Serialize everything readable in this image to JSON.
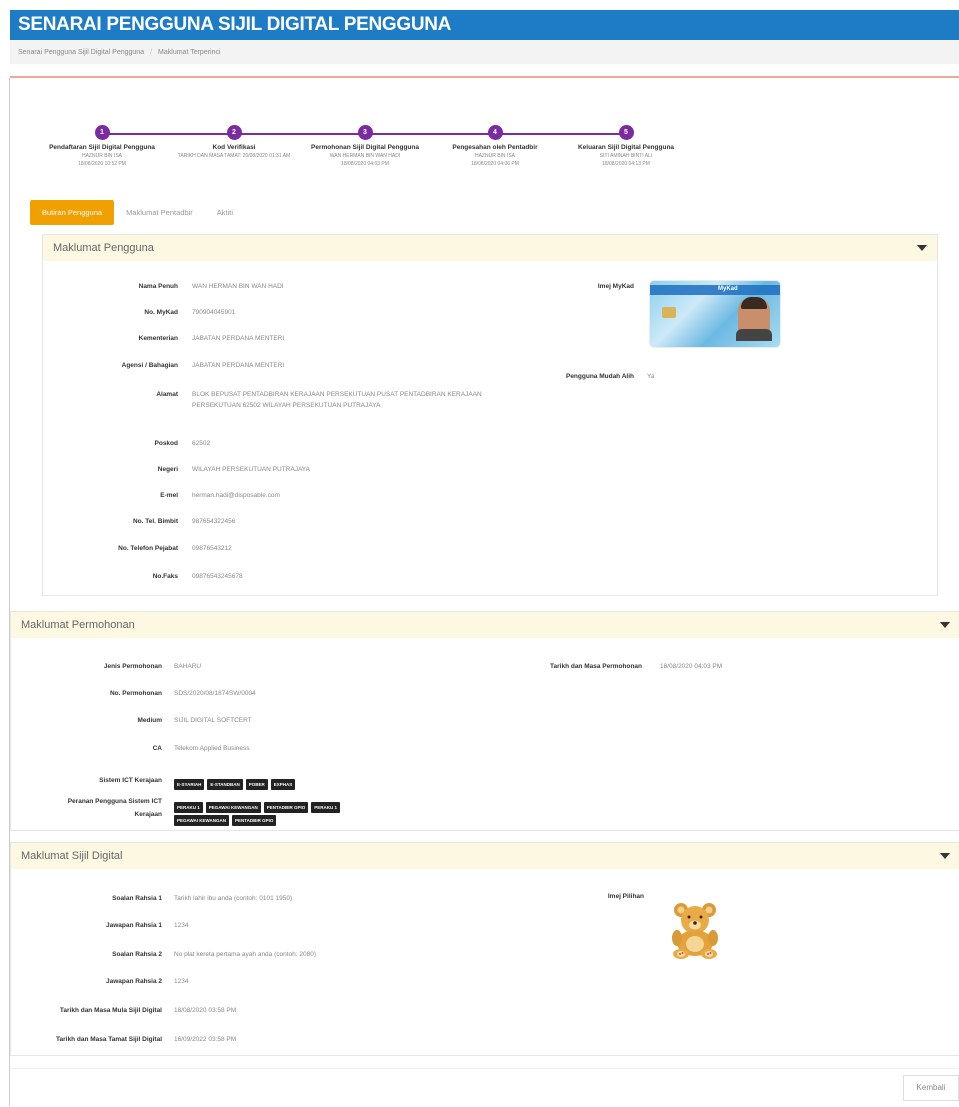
{
  "header": {
    "title": "SENARAI PENGGUNA SIJIL DIGITAL PENGGUNA"
  },
  "breadcrumb": {
    "items": [
      "Senarai Pengguna Sijil Digital Pengguna",
      "Maklumat Terperinci"
    ]
  },
  "stepper": {
    "steps": [
      {
        "num": "1",
        "title": "Pendaftaran Sijil Digital Pengguna",
        "sub1": "HAZNUR BIN ISA",
        "sub2": "18/08/2020 10:52 PM"
      },
      {
        "num": "2",
        "title": "Kod Verifikasi",
        "sub1": "TARIKH DAN MASA TAMAT: 20/08/2020 01:31 AM",
        "sub2": ""
      },
      {
        "num": "3",
        "title": "Permohonan Sijil Digital Pengguna",
        "sub1": "WAN HERMAN BIN WAN HADI",
        "sub2": "18/08/2020 04:03 PM"
      },
      {
        "num": "4",
        "title": "Pengesahan oleh Pentadbir",
        "sub1": "HAZNUR BIN ISA",
        "sub2": "18/08/2020 04:06 PM"
      },
      {
        "num": "5",
        "title": "Keluaran Sijil Digital Pengguna",
        "sub1": "SITI AMINAH BINTI ALI",
        "sub2": "18/08/2020 04:13 PM"
      }
    ]
  },
  "tabs": [
    {
      "label": "Butiran Pengguna",
      "active": true
    },
    {
      "label": "Maklumat Pentadbir",
      "active": false
    },
    {
      "label": "Aktiti",
      "active": false
    }
  ],
  "pengguna": {
    "heading": "Maklumat Pengguna",
    "fields": [
      {
        "label": "Nama Penuh",
        "value": "WAN HERMAN BIN WAN HADI"
      },
      {
        "label": "No. MyKad",
        "value": "790904045901"
      },
      {
        "label": "Kementerian",
        "value": "JABATAN PERDANA MENTERI"
      },
      {
        "label": "Agensi / Bahagian",
        "value": "JABATAN PERDANA MENTERI"
      },
      {
        "label": "Alamat",
        "value": "BLOK BEPUSAT PENTADBIRAN KERAJAAN PERSEKUTUAN PUSAT PENTADBIRAN KERAJAAN PERSEKUTUAN 62502 WILAYAH PERSEKUTUAN PUTRAJAYA"
      },
      {
        "label": "Poskod",
        "value": "62502"
      },
      {
        "label": "Negeri",
        "value": "WILAYAH PERSEKUTUAN PUTRAJAYA"
      },
      {
        "label": "E-mel",
        "value": "herman.hadi@disposable.com"
      },
      {
        "label": "No. Tel. Bimbit",
        "value": "987654322456"
      },
      {
        "label": "No. Telefon Pejabat",
        "value": "09876543212"
      },
      {
        "label": "No.Faks",
        "value": "09876543245678"
      }
    ],
    "mykad_label": "Imej MyKad",
    "mykad_card_text": "MyKad",
    "mudah_alih_label": "Pengguna Mudah Alih",
    "mudah_alih_value": "Ya"
  },
  "permohonan": {
    "heading": "Maklumat Permohonan",
    "fields": [
      {
        "label": "Jenis Permohonan",
        "value": "BAHARU"
      },
      {
        "label": "No. Permohonan",
        "value": "SDS/2020/08/1874SW/0004"
      },
      {
        "label": "Medium",
        "value": "SIJIL DIGITAL SOFTCERT"
      },
      {
        "label": "CA",
        "value": "Telekom Applied Business"
      }
    ],
    "tarikh_label": "Tarikh dan Masa Permohonan",
    "tarikh_value": "18/08/2020 04:03 PM",
    "sistem_label": "Sistem ICT Kerajaan",
    "sistem_tags": [
      "E-SYARIAH",
      "E-STANDBAN",
      "POBER",
      "EXPHAS"
    ],
    "peranan_label1": "Peranan Pengguna Sistem ICT",
    "peranan_label2": "Kerajaan",
    "peranan_tags_row1": [
      "PERAKU 1",
      "PEGAWAI KEWANGAN",
      "PENTADBIR GPIO",
      "PERAKU 1"
    ],
    "peranan_tags_row2": [
      "PEGAWAI KEWANGAN",
      "PENTADBIR GPIO"
    ]
  },
  "sijil": {
    "heading": "Maklumat Sijil Digital",
    "fields": [
      {
        "label": "Soalan Rahsia 1",
        "value": "Tarikh lahir ibu anda (contoh: 0101 1950)"
      },
      {
        "label": "Jawapan Rahsia 1",
        "value": "1234"
      },
      {
        "label": "Soalan Rahsia 2",
        "value": "No plat kereta pertama ayah anda (contoh: 2080)"
      },
      {
        "label": "Jawapan Rahsia 2",
        "value": "1234"
      },
      {
        "label": "Tarikh dan Masa Mula Sijil Digital",
        "value": "18/08/2020 03:58 PM"
      },
      {
        "label": "Tarikh dan Masa Tamat Sijil Digital",
        "value": "16/09/2022 03:58 PM"
      }
    ],
    "imej_label": "Imej Pilihan"
  },
  "footer": {
    "back_label": "Kembali"
  },
  "colors": {
    "header": "#1e7cc7",
    "stepper": "#7b2aa0",
    "active_tab": "#f0a000",
    "panel_head": "#fdf8e1"
  }
}
